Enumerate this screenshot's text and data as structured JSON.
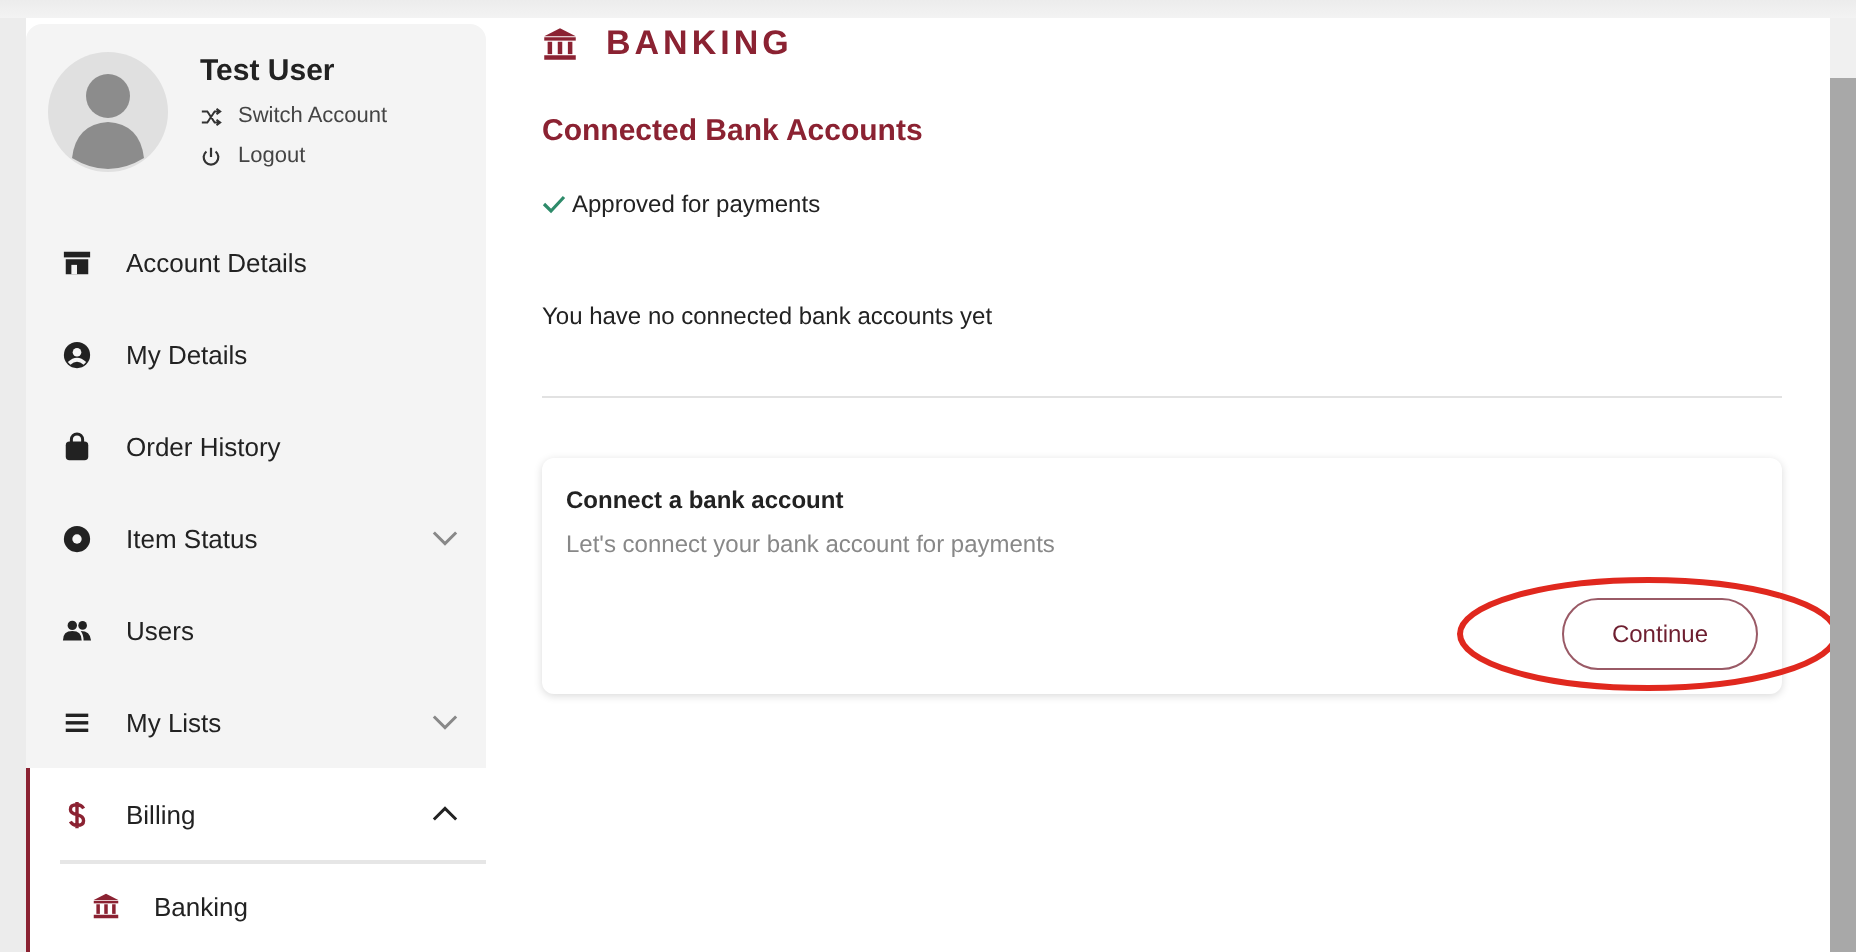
{
  "profile": {
    "name": "Test User",
    "actions": [
      {
        "label": "Switch Account"
      },
      {
        "label": "Logout"
      }
    ]
  },
  "sidebar": {
    "items": [
      {
        "label": "Account Details",
        "selected": false
      },
      {
        "label": "My Details",
        "selected": false
      },
      {
        "label": "Order History",
        "selected": false
      },
      {
        "label": "Item Status",
        "selected": false,
        "expanded": false
      },
      {
        "label": "Users",
        "selected": false
      },
      {
        "label": "My Lists",
        "selected": false,
        "expanded": false
      },
      {
        "label": "Billing",
        "selected": true,
        "expanded": true,
        "children": [
          {
            "label": "Banking",
            "selected": true
          }
        ]
      }
    ]
  },
  "page": {
    "title": "BANKING",
    "section_title": "Connected Bank Accounts",
    "status": {
      "label": "Approved for payments",
      "approved": true
    },
    "empty_message": "You have no connected bank accounts yet",
    "card": {
      "title": "Connect a bank account",
      "description": "Let's connect your bank account for payments",
      "button": "Continue",
      "highlight": {
        "kind": "ellipse"
      }
    }
  }
}
